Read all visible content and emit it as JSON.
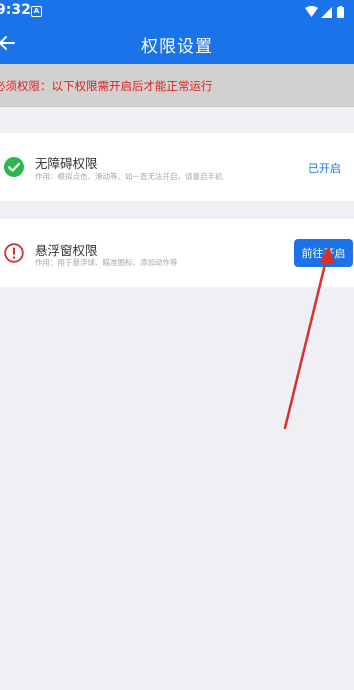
{
  "status_bar": {
    "time": "9:32",
    "app_icon_glyph": "A",
    "icons": [
      "wifi-icon",
      "signal-icon",
      "battery-icon"
    ]
  },
  "header": {
    "title": "权限设置",
    "back_icon": "arrow-left-icon"
  },
  "notice": {
    "text": "必须权限：以下权限需开启后才能正常运行"
  },
  "permissions": [
    {
      "title": "无障碍权限",
      "description": "作用：模拟点击、滑动等。如一直无法开启，请重启手机",
      "icon": "check-circle-icon",
      "status": "已开启"
    },
    {
      "title": "悬浮窗权限",
      "description": "作用：用于悬浮球、瞄准图标、添加动作等",
      "icon": "alert-circle-icon",
      "action_label": "前往开启"
    }
  ],
  "colors": {
    "primary": "#1a73e8",
    "warning_text": "#e02020",
    "success": "#2db84d",
    "error": "#d9302c",
    "annotation_arrow": "#d9302c",
    "background": "#efeff4"
  }
}
